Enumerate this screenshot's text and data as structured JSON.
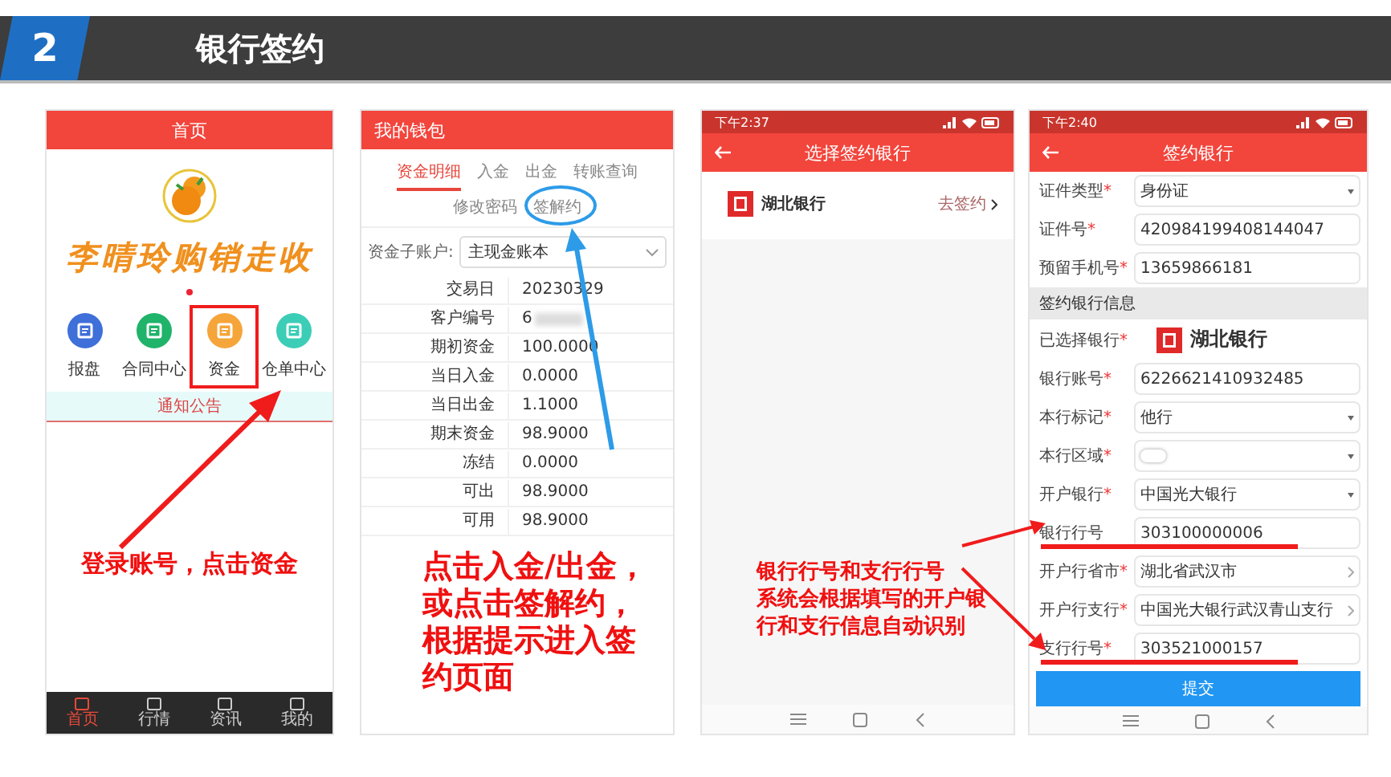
{
  "header": {
    "number": "2",
    "title": "银行签约"
  },
  "home_screen": {
    "title": "首页",
    "brand": "李晴玲购销走收",
    "shortcuts": [
      {
        "label": "报盘",
        "color": "#3f6fd8",
        "highlighted": false
      },
      {
        "label": "合同中心",
        "color": "#20b36a",
        "highlighted": false
      },
      {
        "label": "资金",
        "color": "#f5a53a",
        "highlighted": true
      },
      {
        "label": "仓单中心",
        "color": "#3ccdb7",
        "highlighted": false
      }
    ],
    "notice": "通知公告",
    "nav": [
      {
        "label": "首页",
        "selected": true
      },
      {
        "label": "行情",
        "selected": false
      },
      {
        "label": "资讯",
        "selected": false
      },
      {
        "label": "我的",
        "selected": false
      }
    ],
    "annotation": "登录账号，点击资金"
  },
  "wallet_screen": {
    "title": "我的钱包",
    "tabs": [
      {
        "label": "资金明细",
        "selected": true
      },
      {
        "label": "入金",
        "selected": false
      },
      {
        "label": "出金",
        "selected": false
      },
      {
        "label": "转账查询",
        "selected": false
      },
      {
        "label": "修改密码",
        "selected": false
      },
      {
        "label": "签解约",
        "selected": false
      }
    ],
    "account_label": "资金子账户:",
    "account_value": "主现金账本",
    "rows": [
      {
        "label": "交易日",
        "value": "20230329"
      },
      {
        "label": "客户编号",
        "value": "6",
        "redacted": true
      },
      {
        "label": "期初资金",
        "value": "100.0000"
      },
      {
        "label": "当日入金",
        "value": "0.0000"
      },
      {
        "label": "当日出金",
        "value": "1.1000"
      },
      {
        "label": "期末资金",
        "value": "98.9000"
      },
      {
        "label": "冻结",
        "value": "0.0000"
      },
      {
        "label": "可出",
        "value": "98.9000"
      },
      {
        "label": "可用",
        "value": "98.9000"
      }
    ],
    "annotation": "点击入金/出金，或点击签解约，根据提示进入签约页面"
  },
  "bank_select_screen": {
    "time": "下午2:37",
    "title": "选择签约银行",
    "bank": "湖北银行",
    "action": "去签约",
    "annotation_title": "银行行号和支行行号",
    "annotation_body": "系统会根据填写的开户银行和支行信息自动识别"
  },
  "bank_sign_screen": {
    "time": "下午2:40",
    "title": "签约银行",
    "fields": [
      {
        "kind": "select",
        "label": "证件类型",
        "mark": "*",
        "value": "身份证"
      },
      {
        "kind": "input",
        "label": "证件号",
        "mark": "*",
        "value": "420984199408144047"
      },
      {
        "kind": "input",
        "label": "预留手机号",
        "mark": "*",
        "value": "13659866181"
      },
      {
        "kind": "section",
        "label": "签约银行信息"
      },
      {
        "kind": "bank",
        "label": "已选择银行",
        "mark": "*",
        "value": "湖北银行"
      },
      {
        "kind": "input",
        "label": "银行账号",
        "mark": "*",
        "value": "6226621410932485"
      },
      {
        "kind": "select",
        "label": "本行标记",
        "mark": "*",
        "value": "他行"
      },
      {
        "kind": "blank_select",
        "label": "本行区域",
        "mark": "*"
      },
      {
        "kind": "select",
        "label": "开户银行",
        "mark": "*",
        "value": "中国光大银行"
      },
      {
        "kind": "input",
        "label": "银行行号",
        "value": "303100000006"
      },
      {
        "kind": "link",
        "label": "开户行省市",
        "mark": "*",
        "value": "湖北省武汉市"
      },
      {
        "kind": "link",
        "label": "开户行支行",
        "mark": "*",
        "value": "中国光大银行武汉青山支行"
      },
      {
        "kind": "input",
        "label": "支行行号",
        "mark": "*",
        "value": "303521000157"
      }
    ],
    "submit": "提交"
  }
}
